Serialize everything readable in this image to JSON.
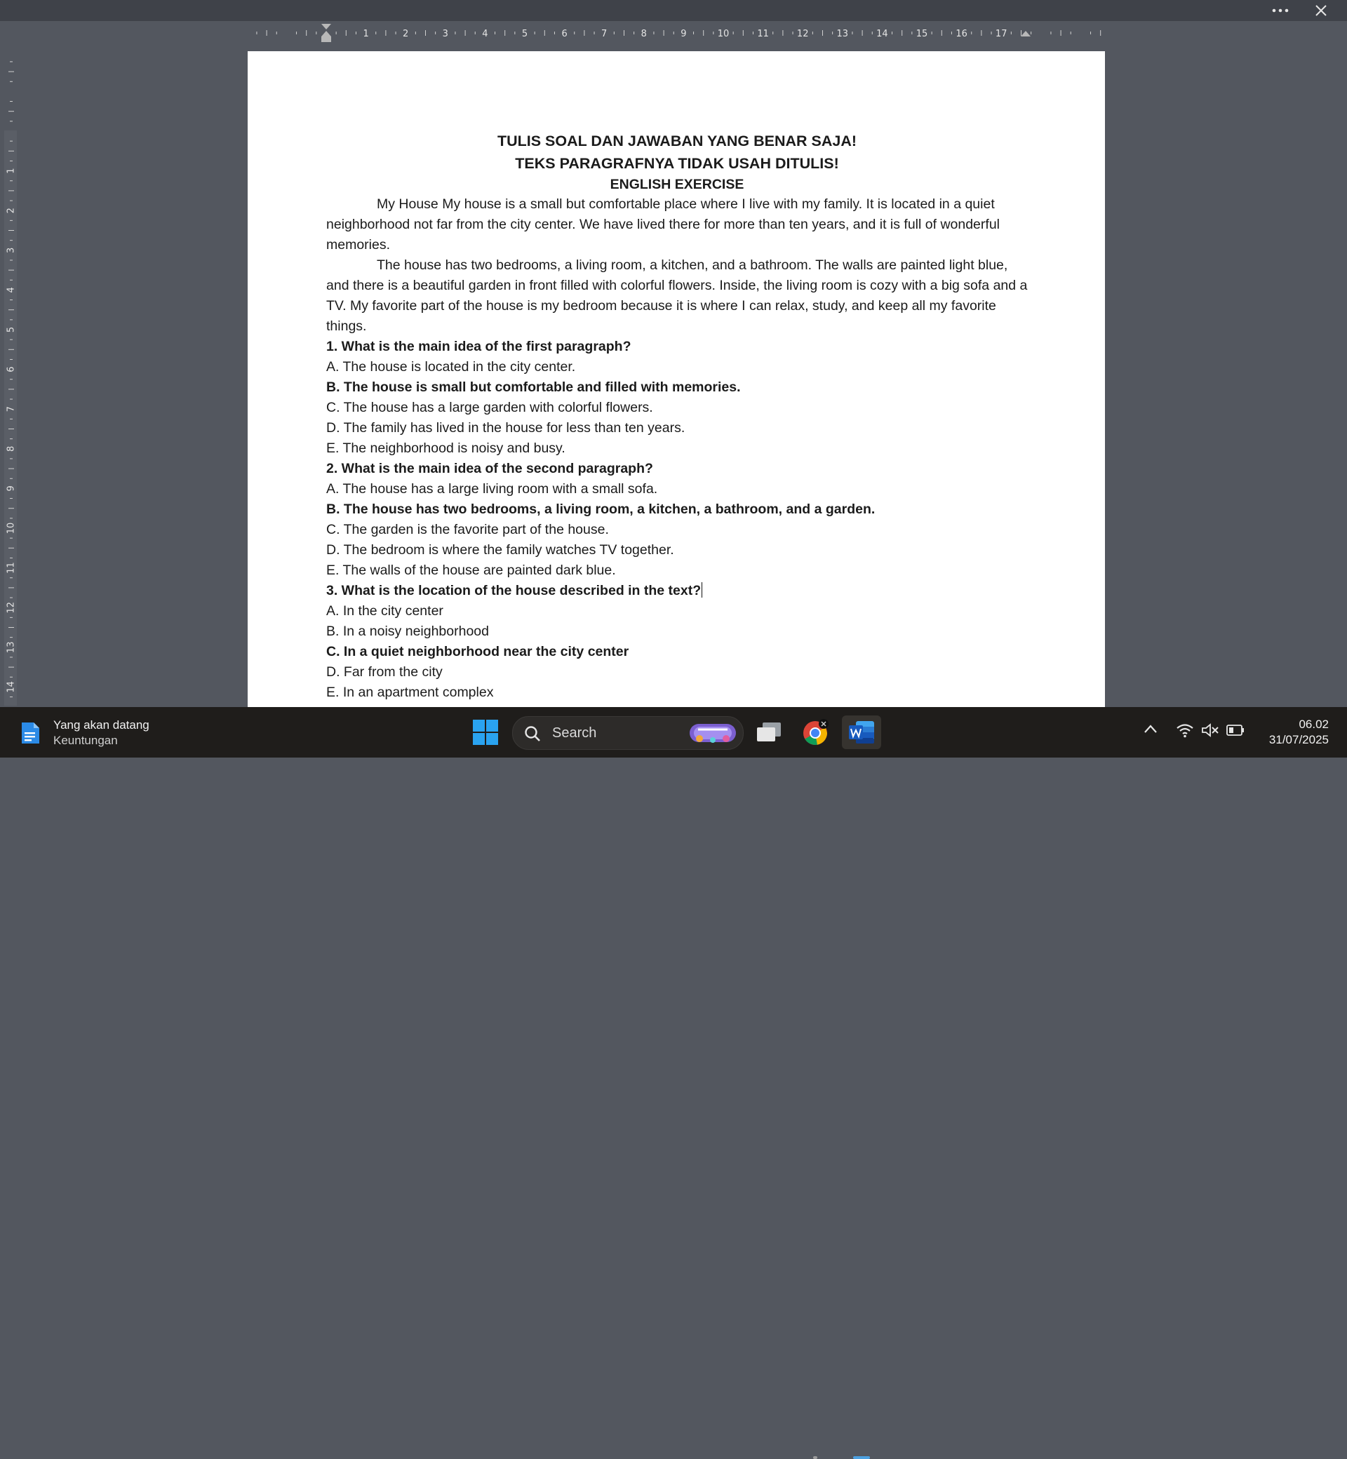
{
  "window": {
    "more_icon": "more-horizontal-icon",
    "close_icon": "close-icon"
  },
  "ruler": {
    "horizontal_numbers": [
      "1",
      "2",
      "3",
      "4",
      "5",
      "6",
      "7",
      "8",
      "9",
      "10",
      "11",
      "12",
      "13",
      "14",
      "15",
      "16",
      "17"
    ],
    "vertical_numbers": [
      "1",
      "2",
      "3",
      "4",
      "5",
      "6",
      "7",
      "8",
      "9",
      "10",
      "11",
      "12",
      "13",
      "14"
    ]
  },
  "document": {
    "heading1": "TULIS SOAL DAN JAWABAN YANG BENAR SAJA!",
    "heading2": "TEKS PARAGRAFNYA TIDAK USAH DITULIS!",
    "heading3": "ENGLISH EXERCISE",
    "paragraph1": "My House My house is a small but comfortable place where I live with my family. It is located in a quiet neighborhood not far from the city center. We have lived there for more than ten years, and it is full of wonderful memories.",
    "paragraph2": "The house has two bedrooms, a living room, a kitchen, and a bathroom. The walls are painted light blue, and there is a beautiful garden in front filled with colorful flowers. Inside, the living room is cozy with a big sofa and a TV. My favorite part of the house is my bedroom because it is where I can relax, study, and keep all my favorite things.",
    "questions": [
      {
        "question": "1. What is the main idea of the first paragraph?",
        "options": [
          "A. The house is located in the city center.",
          "B. The house is small but comfortable and filled with memories.",
          "C. The house has a large garden with colorful flowers.",
          "D. The family has lived in the house for less than ten years.",
          "E. The neighborhood is noisy and busy."
        ]
      },
      {
        "question": "2. What is the main idea of the second paragraph?",
        "options": [
          "A. The house has a large living room with a small sofa.",
          "B. The house has two bedrooms, a living room, a kitchen, a bathroom, and a garden.",
          "C. The garden is the favorite part of the house.",
          "D. The bedroom is where the family watches TV together.",
          "E. The walls of the house are painted dark blue."
        ]
      },
      {
        "question": "3. What is the location of the house described in the text?",
        "options": [
          "A. In the city center",
          "B. In a noisy neighborhood",
          "C. In a quiet neighborhood near the city center",
          "D. Far from the city",
          "E. In an apartment complex"
        ]
      }
    ]
  },
  "taskbar": {
    "widget_title": "Yang akan datang",
    "widget_subtitle": "Keuntungan",
    "widget_icon": "stocks-icon",
    "search_placeholder": "Search",
    "apps": [
      "start-icon",
      "task-view-icon",
      "chrome-icon",
      "word-icon"
    ],
    "tray_icons": [
      "chevron-up-icon",
      "wifi-icon",
      "volume-muted-icon",
      "battery-icon"
    ],
    "time": "06.02",
    "date": "31/07/2025"
  },
  "colors": {
    "workspace": "#53575f",
    "page": "#ffffff",
    "taskbar": "#1f1d1b",
    "word_blue": "#185abd",
    "windows_blue": "#2aa3f0"
  }
}
